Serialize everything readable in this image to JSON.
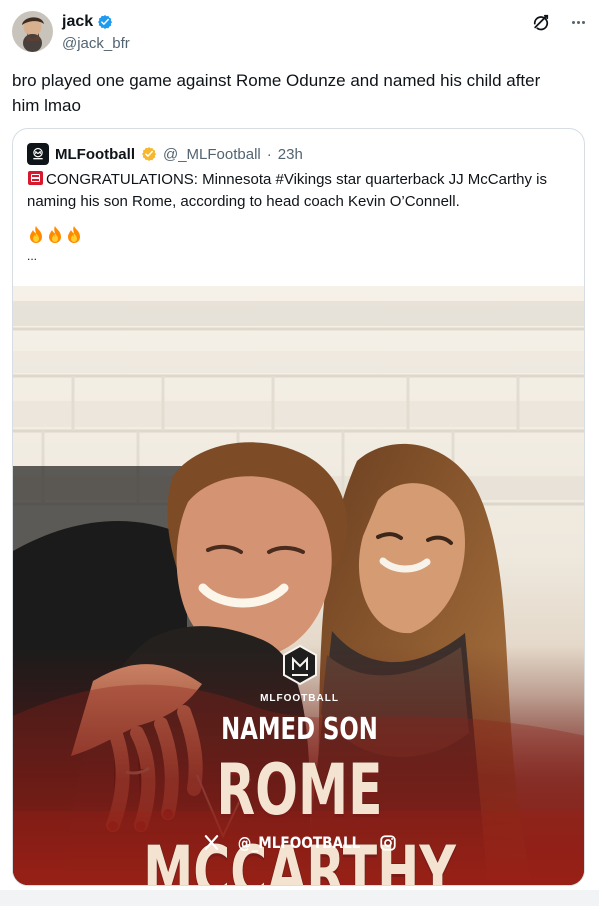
{
  "post": {
    "author": {
      "display_name": "jack",
      "handle": "@jack_bfr"
    },
    "text": "bro played one game against Rome Odunze and named his child after him lmao"
  },
  "quoted_post": {
    "author": {
      "display_name": "MLFootball",
      "handle": "@_MLFootball",
      "separator": "·",
      "time": "23h"
    },
    "body": "CONGRATULATIONS: Minnesota #Vikings star quarterback JJ McCarthy is naming his son Rome, according to head coach Kevin O’Connell.",
    "ellipsis": "...",
    "image": {
      "brand_label": "MLFOOTBALL",
      "subheadline": "NAMED SON",
      "headline": "ROME MCCARTHY",
      "social_handle": "@_MLFOOTBALL"
    }
  },
  "icons": {
    "verified": "verified-badge-icon",
    "gold_verified": "gold-verified-badge-icon",
    "grok": "grok-icon",
    "more": "more-icon",
    "fire": "fire-emoji-icon",
    "siren": "police-light-icon",
    "x": "x-logo-icon",
    "instagram": "instagram-icon"
  },
  "colors": {
    "text_primary": "#0f1419",
    "text_secondary": "#536471",
    "verified_blue": "#1d9bf0",
    "verified_gold": "#f5b82e",
    "headline_red": "#b8231f"
  }
}
